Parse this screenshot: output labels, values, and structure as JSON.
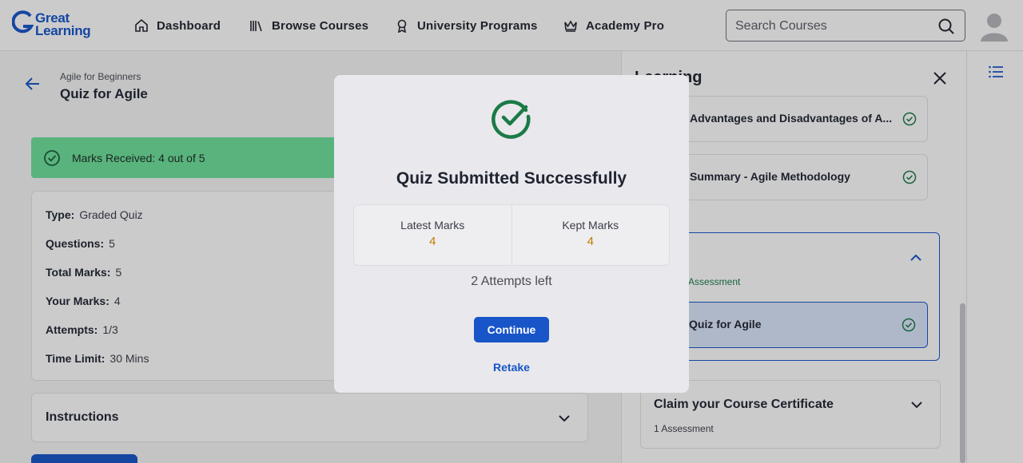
{
  "header": {
    "logo_line1": "Great",
    "logo_line2": "Learning",
    "nav": [
      {
        "label": "Dashboard",
        "icon": "home-icon"
      },
      {
        "label": "Browse Courses",
        "icon": "books-icon"
      },
      {
        "label": "University Programs",
        "icon": "award-icon"
      },
      {
        "label": "Academy Pro",
        "icon": "crown-icon"
      }
    ],
    "search_placeholder": "Search Courses"
  },
  "quiz_page": {
    "breadcrumb": "Agile for Beginners",
    "title": "Quiz for Agile",
    "marks_banner": "Marks Received: 4 out of 5",
    "details": [
      {
        "label": "Type:",
        "value": "Graded Quiz"
      },
      {
        "label": "Questions:",
        "value": "5"
      },
      {
        "label": "Total Marks:",
        "value": "5"
      },
      {
        "label": "Your Marks:",
        "value": "4"
      },
      {
        "label": "Attempts:",
        "value": "1/3"
      },
      {
        "label": "Time Limit:",
        "value": "30 Mins"
      }
    ],
    "instructions_label": "Instructions"
  },
  "learning_panel": {
    "title": "Learning",
    "items": [
      "Advantages and Disadvantages of A...",
      "Summary - Agile Methodology"
    ],
    "module_subtitle": "Assessment",
    "active_item": "Quiz for Agile",
    "certificate": {
      "title": "Claim your Course Certificate",
      "subtitle": "1 Assessment"
    }
  },
  "modal": {
    "title": "Quiz Submitted Successfully",
    "latest_label": "Latest Marks",
    "latest_value": "4",
    "kept_label": "Kept Marks",
    "kept_value": "4",
    "attempts_left": "2 Attempts left",
    "continue_label": "Continue",
    "retake_label": "Retake"
  },
  "colors": {
    "brand": "#1755c8",
    "success": "#1b7a47",
    "marks_value": "#c27a00",
    "banner": "#6ee19a"
  }
}
